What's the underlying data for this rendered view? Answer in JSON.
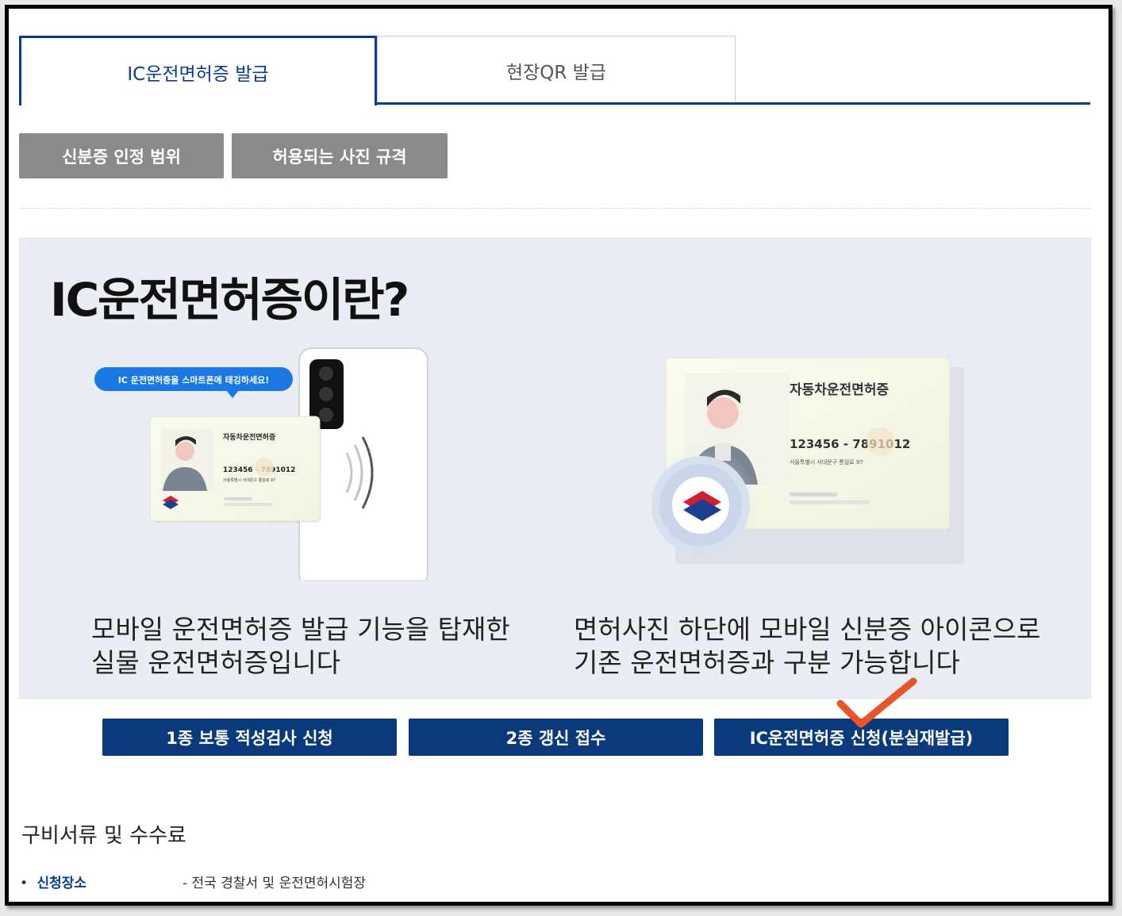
{
  "tabs": [
    {
      "label": "IC운전면허증 발급",
      "active": true
    },
    {
      "label": "현장QR 발급",
      "active": false
    }
  ],
  "gray_buttons": {
    "id_scope": "신분증 인정 범위",
    "photo_spec": "허용되는 사진 규격"
  },
  "info": {
    "title": "IC운전면허증이란?",
    "left_bubble": "IC 운전면허증을 스마트폰에 태깅하세요!",
    "card_title": "자동차운전면허증",
    "card_number": "123456 - 7891012",
    "card_address": "서울특별시 서대문구 통일로 97",
    "left_desc_line1": "모바일 운전면허증 발급 기능을 탑재한",
    "left_desc_line2": "실물 운전면허증입니다",
    "right_desc_line1": "면허사진 하단에 모바일 신분증 아이콘으로",
    "right_desc_line2": "기존 운전면허증과 구분 가능합니다"
  },
  "actions": {
    "class1_aptitude": "1종 보통 적성검사 신청",
    "class2_renewal": "2종 갱신 접수",
    "ic_apply": "IC운전면허증 신청(분실재발급)"
  },
  "requirements": {
    "title": "구비서류 및 수수료",
    "items": [
      {
        "bullet": "•",
        "label": "신청장소",
        "value": "- 전국 경찰서 및 운전면허시험장"
      }
    ]
  },
  "colors": {
    "brand_blue": "#0a3d8f",
    "button_blue": "#0a3a7c",
    "gray_button": "#8a8a8a",
    "annotation_check": "#e8552a"
  }
}
